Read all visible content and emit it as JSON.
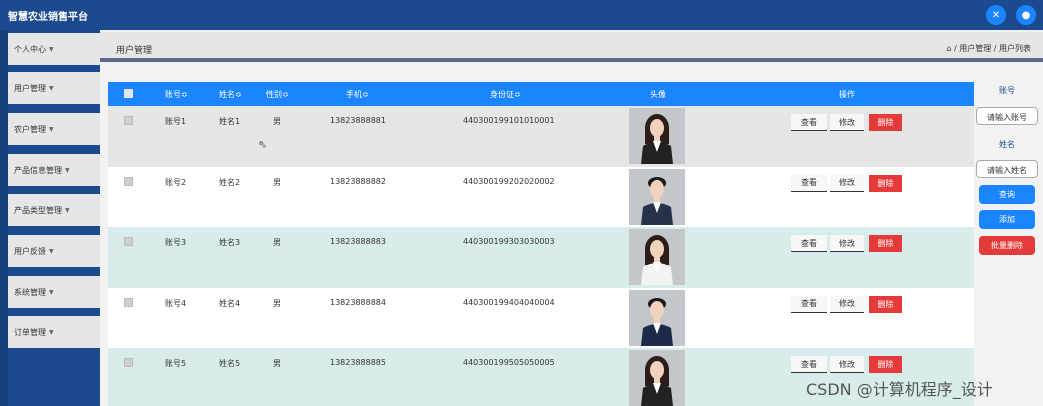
{
  "app": {
    "title": "智慧农业销售平台"
  },
  "topbar": {
    "expand_icon": "✕",
    "user_icon": "●"
  },
  "sidebar": {
    "items": [
      {
        "label": "个人中心"
      },
      {
        "label": "用户管理"
      },
      {
        "label": "农户管理"
      },
      {
        "label": "产品信息管理"
      },
      {
        "label": "产品类型管理"
      },
      {
        "label": "用户反馈"
      },
      {
        "label": "系统管理"
      },
      {
        "label": "订单管理"
      }
    ]
  },
  "header": {
    "title": "用户管理",
    "breadcrumb": "⌂ / 用户管理 / 用户列表"
  },
  "table": {
    "columns": {
      "account": "账号≎",
      "name": "姓名≎",
      "gender": "性别≎",
      "phone": "手机≎",
      "id_card": "身份证≎",
      "avatar": "头像",
      "actions": "操作"
    },
    "rows": [
      {
        "account": "账号1",
        "name": "姓名1",
        "gender": "男",
        "phone": "13823888881",
        "id_card": "440300199101010001",
        "bg": "#e6e6e6",
        "avatar": "female",
        "suit": "#222222"
      },
      {
        "account": "账号2",
        "name": "姓名2",
        "gender": "男",
        "phone": "13823888882",
        "id_card": "440300199202020002",
        "bg": "#ffffff",
        "avatar": "male",
        "suit": "#26324a"
      },
      {
        "account": "账号3",
        "name": "姓名3",
        "gender": "男",
        "phone": "13823888883",
        "id_card": "440300199303030003",
        "bg": "#d8ecec",
        "avatar": "female",
        "suit": "#f3f3f3"
      },
      {
        "account": "账号4",
        "name": "姓名4",
        "gender": "男",
        "phone": "13823888884",
        "id_card": "440300199404040004",
        "bg": "#ffffff",
        "avatar": "male",
        "suit": "#1c2a4a"
      },
      {
        "account": "账号5",
        "name": "姓名5",
        "gender": "男",
        "phone": "13823888885",
        "id_card": "440300199505050005",
        "bg": "#d8ecec",
        "avatar": "female",
        "suit": "#222222"
      }
    ],
    "view_label": "查看",
    "edit_label": "修改",
    "delete_label": "删除"
  },
  "search": {
    "account_label": "账号",
    "account_placeholder": "请输入账号",
    "name_label": "姓名",
    "name_placeholder": "请输入姓名",
    "query_label": "查询",
    "add_label": "添加",
    "batch_delete_label": "批量删除"
  },
  "watermark": "CSDN @计算机程序_设计",
  "colors": {
    "brand": "#1b4a8f",
    "primary": "#1b84ff",
    "danger": "#e53a3a"
  }
}
